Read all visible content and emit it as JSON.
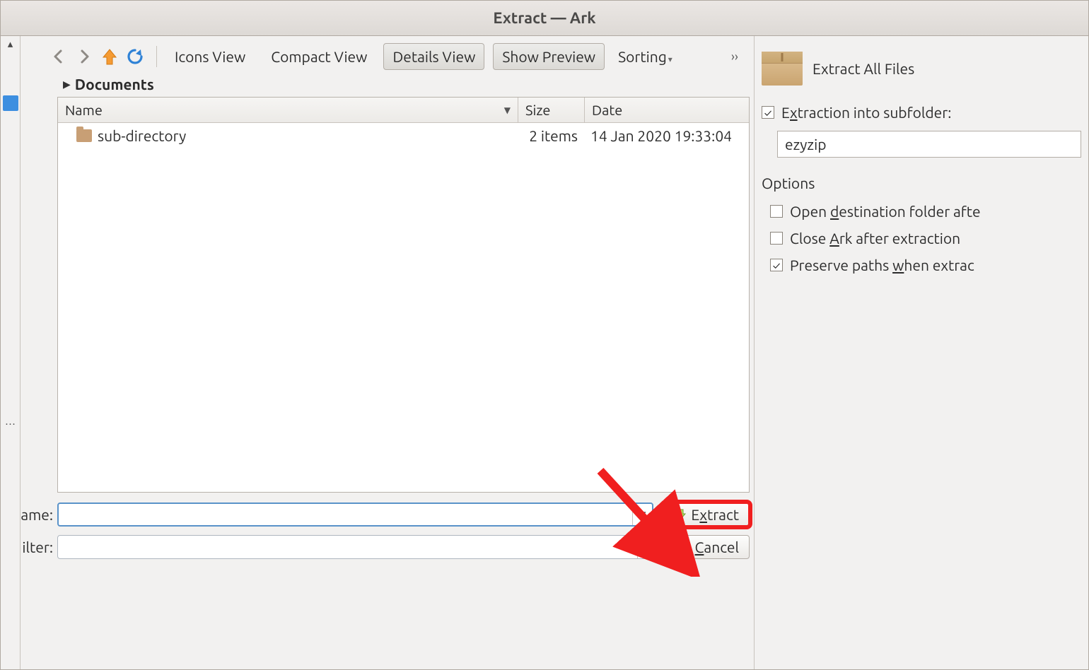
{
  "window": {
    "title": "Extract — Ark"
  },
  "toolbar": {
    "icons_view": "Icons View",
    "compact_view": "Compact View",
    "details_view": "Details View",
    "show_preview": "Show Preview",
    "sorting": "Sorting"
  },
  "breadcrumb": {
    "location": "Documents"
  },
  "columns": {
    "name": "Name",
    "size": "Size",
    "date": "Date"
  },
  "rows": {
    "0": {
      "name": "sub-directory",
      "size": "2 items",
      "date": "14 Jan 2020 19:33:04"
    }
  },
  "bottom": {
    "name_label": "ame:",
    "filter_label": "ilter:",
    "name_value": "",
    "filter_value": "",
    "extract_pre": "E",
    "extract_u": "x",
    "extract_post": "tract",
    "cancel_u": "C",
    "cancel_post": "ancel"
  },
  "side": {
    "header": "Extract All Files",
    "subfolder_pre": "E",
    "subfolder_u": "x",
    "subfolder_post": "traction into subfolder:",
    "subfolder_value": "ezyzip",
    "options": "Options",
    "open_dest_pre": "Open ",
    "open_dest_u": "d",
    "open_dest_post": "estination folder afte",
    "close_ark_pre": "Close ",
    "close_ark_u": "A",
    "close_ark_post": "rk after extraction",
    "preserve_pre": "Preserve paths ",
    "preserve_u": "w",
    "preserve_post": "hen extrac"
  }
}
